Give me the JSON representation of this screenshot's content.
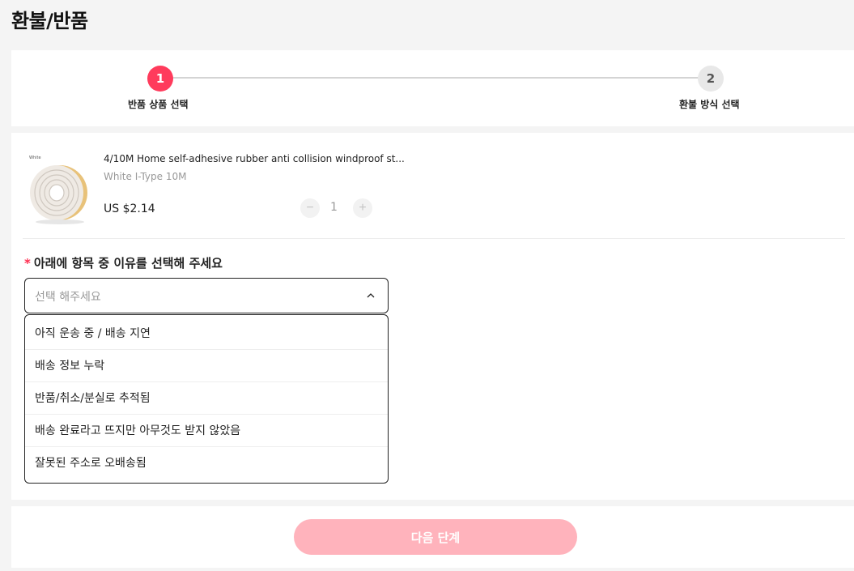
{
  "page": {
    "title": "환불/반품"
  },
  "steps": [
    {
      "number": "1",
      "label": "반품 상품 선택"
    },
    {
      "number": "2",
      "label": "환불 방식 선택"
    }
  ],
  "product": {
    "name": "4/10M Home self-adhesive rubber anti collision windproof st...",
    "variant": "White I-Type 10M",
    "price": "US $2.14",
    "quantity": "1",
    "image_caption": "White"
  },
  "reason": {
    "required_mark": "*",
    "label": "아래에 항목 중 이유를 선택해 주세요",
    "placeholder": "선택 해주세요",
    "options": [
      "아직 운송 중 / 배송 지연",
      "배송 정보 누락",
      "반품/취소/분실로 추적됨",
      "배송 완료라고 뜨지만 아무것도 받지 않았음",
      "잘못된 주소로 오배송됨"
    ]
  },
  "footer": {
    "next_label": "다음 단계"
  },
  "colors": {
    "accent": "#ff3b5c",
    "button_disabled": "#ffb3bc"
  }
}
